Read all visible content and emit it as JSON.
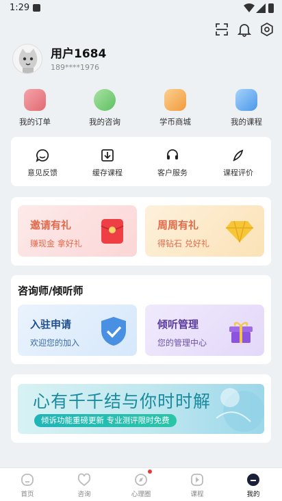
{
  "status_bar": {
    "time": "1:29"
  },
  "profile": {
    "name": "用户1684",
    "phone": "189****1976"
  },
  "quick_row": [
    {
      "label": "我的订单",
      "icon": "order-icon",
      "color": "#e8727a"
    },
    {
      "label": "我的咨询",
      "icon": "consult-heart-icon",
      "color": "#7fcf7d"
    },
    {
      "label": "学币商城",
      "icon": "coin-shop-icon",
      "color": "#f6a95a"
    },
    {
      "label": "我的课程",
      "icon": "course-icon",
      "color": "#5aa6ee"
    }
  ],
  "services": [
    {
      "label": "意见反馈",
      "icon": "feedback-icon"
    },
    {
      "label": "缓存课程",
      "icon": "download-icon"
    },
    {
      "label": "客户服务",
      "icon": "headset-icon"
    },
    {
      "label": "课程评价",
      "icon": "pen-icon"
    }
  ],
  "promos": [
    {
      "title": "邀请有礼",
      "subtitle": "赚现金 拿好礼"
    },
    {
      "title": "周周有礼",
      "subtitle": "得钻石 兑好礼"
    }
  ],
  "counselor": {
    "title": "咨询师/倾听师",
    "cards": [
      {
        "title": "入驻申请",
        "subtitle": "欢迎您的加入"
      },
      {
        "title": "倾听管理",
        "subtitle": "您的管理中心"
      }
    ]
  },
  "banner": {
    "headline": "心有千千结与你时时解",
    "tagline": "倾诉功能重磅更新 专业测评限时免费"
  },
  "tabs": [
    {
      "label": "首页"
    },
    {
      "label": "咨询"
    },
    {
      "label": "心理圈"
    },
    {
      "label": "课程"
    },
    {
      "label": "我的"
    }
  ]
}
